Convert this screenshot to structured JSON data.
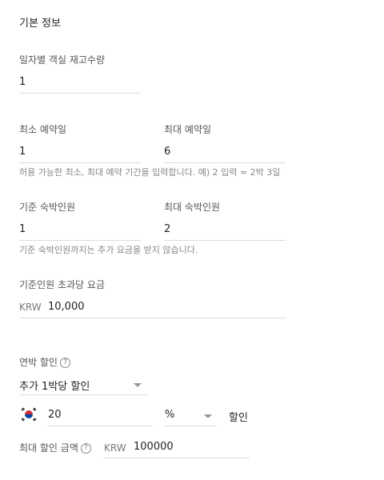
{
  "section": {
    "title": "기본 정보"
  },
  "daily_stock": {
    "label": "일자별 객실 재고수량",
    "value": "1"
  },
  "reservation": {
    "min_label": "최소 예약일",
    "min_value": "1",
    "max_label": "최대 예약일",
    "max_value": "6",
    "help": "허용 가능한 최소, 최대 예약 기간을 입력합니다. 예) 2 입력 = 2박 3일"
  },
  "guests": {
    "base_label": "기준 숙박인원",
    "base_value": "1",
    "max_label": "최대 숙박인원",
    "max_value": "2",
    "help": "기준 숙박인원까지는 추가 요금을 받지 않습니다."
  },
  "extra_fee": {
    "label": "기준인원 초과당 요금",
    "currency": "KRW",
    "value": "10,000"
  },
  "long_stay": {
    "label": "연박 할인",
    "help_icon": "question-circle-icon",
    "discount_type": "추가 1박당 할인",
    "flag_icon": "korea-flag-icon",
    "discount_value": "20",
    "discount_unit": "%",
    "discount_suffix": "할인",
    "max_label": "최대 할인 금액",
    "max_currency": "KRW",
    "max_value": "100000"
  }
}
